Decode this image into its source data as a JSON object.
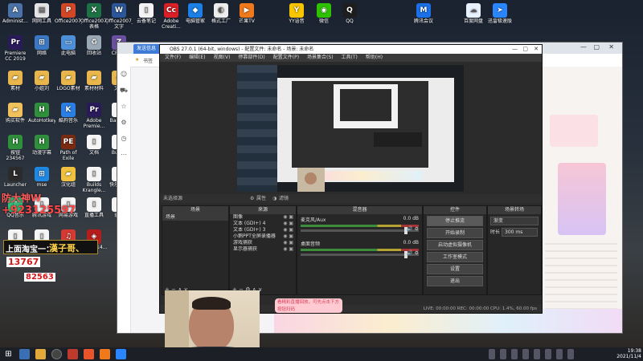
{
  "desktop": {
    "icons": [
      {
        "label": "Administ...",
        "color": "#4a72a8",
        "glyph": "A"
      },
      {
        "label": "网网工具",
        "color": "#e5e5e5",
        "glyph": "▤"
      },
      {
        "label": "Office2007_...",
        "color": "#d24726",
        "glyph": "P"
      },
      {
        "label": "Office2007_表格",
        "color": "#1e7145",
        "glyph": "X"
      },
      {
        "label": "Office2007_文字",
        "color": "#2b579a",
        "glyph": "W"
      },
      {
        "label": "云备笔记",
        "color": "#f4f4f4",
        "glyph": "▯"
      },
      {
        "label": "Adobe Creati...",
        "color": "#da1f26",
        "glyph": "Cc"
      },
      {
        "label": "电脑管家",
        "color": "#1b7fe6",
        "glyph": "◆"
      },
      {
        "label": "格式工厂",
        "color": "#ededed",
        "glyph": "◐"
      },
      {
        "label": "芒果TV",
        "color": "#f07a1b",
        "glyph": "▶"
      },
      {
        "label": "YY语音",
        "color": "#f7c600",
        "glyph": "Y"
      },
      {
        "label": "微信",
        "color": "#2dc100",
        "glyph": "◉"
      },
      {
        "label": "QQ",
        "color": "#1e1e1e",
        "glyph": "Q"
      },
      {
        "label": "腾讯会议",
        "color": "#1b6fe8",
        "glyph": "M"
      },
      {
        "label": "百度网盘",
        "color": "#e8f1ff",
        "glyph": "☁"
      },
      {
        "label": "迅雷极速版",
        "color": "#2a86ff",
        "glyph": "➤"
      },
      {
        "label": "Premiere CC 2019",
        "color": "#2a1a5a",
        "glyph": "Pr"
      },
      {
        "label": "网络",
        "color": "#3b78c4",
        "glyph": "⊞"
      },
      {
        "label": "此电脑",
        "color": "#4d90d8",
        "glyph": "▭"
      },
      {
        "label": "回收站",
        "color": "#9aa7b5",
        "glyph": "♻"
      },
      {
        "label": "CPU-Z",
        "color": "#6b4fa0",
        "glyph": "Z"
      },
      {
        "label": "素材",
        "color": "#e8b64a",
        "glyph": "▰"
      },
      {
        "label": "小姐刘",
        "color": "#e8b64a",
        "glyph": "▰"
      },
      {
        "label": "LOGO素材",
        "color": "#e8b64a",
        "glyph": "▰"
      },
      {
        "label": "素材材料",
        "color": "#e8b64a",
        "glyph": "▰"
      },
      {
        "label": "文件",
        "color": "#e8b64a",
        "glyph": "▰"
      },
      {
        "label": "购买软件",
        "color": "#f1c15b",
        "glyph": "▰"
      },
      {
        "label": "AutoHotkey",
        "color": "#2f8f3a",
        "glyph": "H"
      },
      {
        "label": "酷狗音乐",
        "color": "#2a7fe5",
        "glyph": "K"
      },
      {
        "label": "Adobe Premie...",
        "color": "#2a1a5a",
        "glyph": "Pr"
      },
      {
        "label": "Bandi...",
        "color": "#f5f5f5",
        "glyph": "▯"
      },
      {
        "label": "按钮234567",
        "color": "#2f8f3a",
        "glyph": "H"
      },
      {
        "label": "动漫字幕",
        "color": "#2f8f3a",
        "glyph": "H"
      },
      {
        "label": "Path of Exile",
        "color": "#7a2a10",
        "glyph": "PE"
      },
      {
        "label": "文档",
        "color": "#f5f5f5",
        "glyph": "▯"
      },
      {
        "label": "Builds",
        "color": "#f5f5f5",
        "glyph": "▯"
      },
      {
        "label": "Launcher",
        "color": "#2b2b2b",
        "glyph": "L"
      },
      {
        "label": "mse",
        "color": "#1e88e5",
        "glyph": "⊞"
      },
      {
        "label": "汉化组",
        "color": "#f0c040",
        "glyph": "▰"
      },
      {
        "label": "Builds Krangle...",
        "color": "#f5f5f5",
        "glyph": "▯"
      },
      {
        "label": "快乐游戏",
        "color": "#f5f5f5",
        "glyph": "▯"
      },
      {
        "label": "QQ音乐",
        "color": "#31c27c",
        "glyph": "♪"
      },
      {
        "label": "腾讯游戏",
        "color": "#f5f5f5",
        "glyph": "▯"
      },
      {
        "label": "网易游戏",
        "color": "#f5f5f5",
        "glyph": "▯"
      },
      {
        "label": "直播工具",
        "color": "#f5f5f5",
        "glyph": "▯"
      },
      {
        "label": "录音",
        "color": "#f5f5f5",
        "glyph": "▯"
      },
      {
        "label": "水木礼盒",
        "color": "#f5f5f5",
        "glyph": "▯"
      },
      {
        "label": "游戏组",
        "color": "#f5f5f5",
        "glyph": "▯"
      },
      {
        "label": "网易云音乐",
        "color": "#d33a31",
        "glyph": "♫"
      },
      {
        "label": "f3401f14...",
        "color": "#b51c1c",
        "glyph": "◈"
      }
    ]
  },
  "browser": {
    "tab_label": "发送信息",
    "bookmark": "书签",
    "side_icons": [
      "user-icon",
      "cart-icon",
      "star-icon",
      "gear-icon",
      "clock-icon",
      "more-icon"
    ]
  },
  "obs": {
    "title": "OBS 27.0.1 (64-bit, windows) - 配置文件: 未命名 - 场景: 未命名",
    "menu": [
      "文件(F)",
      "编辑(E)",
      "视图(V)",
      "停靠部件(D)",
      "配置文件(P)",
      "场景集合(S)",
      "工具(T)",
      "帮助(H)"
    ],
    "bar_text": "未选择源",
    "bar_props": "属性",
    "bar_filters": "滤镜",
    "scenes_header": "场景",
    "scenes": [
      "场景"
    ],
    "sources_header": "来源",
    "sources": [
      "图像",
      "文本 (GDI+) 4",
      "文本 (GDI+) 3",
      "小鹅PPT全屏录播器",
      "游戏捕获",
      "显示器捕获"
    ],
    "mixer_header": "混音器",
    "mixer": [
      {
        "name": "麦克风/Aux",
        "db": "0.0 dB"
      },
      {
        "name": "桌面音频",
        "db": "0.0 dB"
      }
    ],
    "controls_header": "控件",
    "controls": [
      "停止推流",
      "开始录制",
      "启动虚拟摄像机",
      "工作室模式",
      "设置",
      "退出"
    ],
    "transitions_header": "场景转场",
    "transition_type": "渐变",
    "duration_label": "时长",
    "duration_value": "300 ms",
    "status": "LIVE: 00:00:00    REC: 00:00:00    CPU: 1.4%, 60.00 fps"
  },
  "overlays": {
    "line1": "防大神W",
    "line2": "+923125597",
    "line3": "上面淘宝一：",
    "line4": "漢子哥、",
    "line5": "13767",
    "line6": "82563"
  },
  "page_tip": "看精彩直播回放，可先点击下方按钮扫码",
  "taskbar": {
    "time": "19:38",
    "date": "2021/11/4"
  }
}
